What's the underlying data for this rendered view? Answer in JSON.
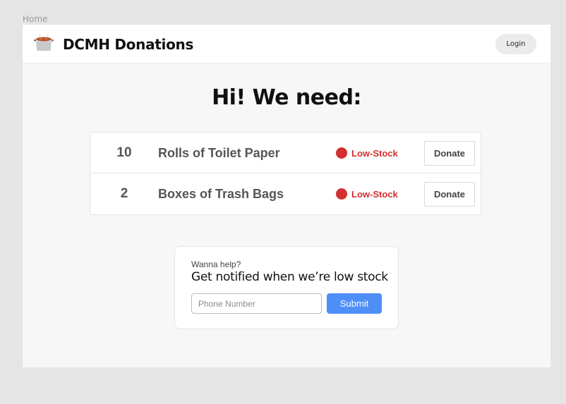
{
  "canvas": {
    "frame_label": "Home"
  },
  "header": {
    "logo_icon": "cooking-pot-icon",
    "brand": "DCMH Donations",
    "login_label": "Login"
  },
  "main": {
    "headline": "Hi! We need:",
    "items": [
      {
        "quantity": "10",
        "name": "Rolls of Toilet Paper",
        "status": "Low-Stock",
        "status_color": "#d32f2f",
        "donate_label": "Donate"
      },
      {
        "quantity": "2",
        "name": "Boxes of Trash Bags",
        "status": "Low-Stock",
        "status_color": "#d32f2f",
        "donate_label": "Donate"
      }
    ]
  },
  "notify": {
    "kicker": "Wanna help?",
    "title": "Get notified when we’re low stock",
    "phone_placeholder": "Phone Number",
    "phone_value": "",
    "submit_label": "Submit"
  },
  "colors": {
    "accent": "#4e8ef7",
    "low_stock": "#d32f2f"
  }
}
